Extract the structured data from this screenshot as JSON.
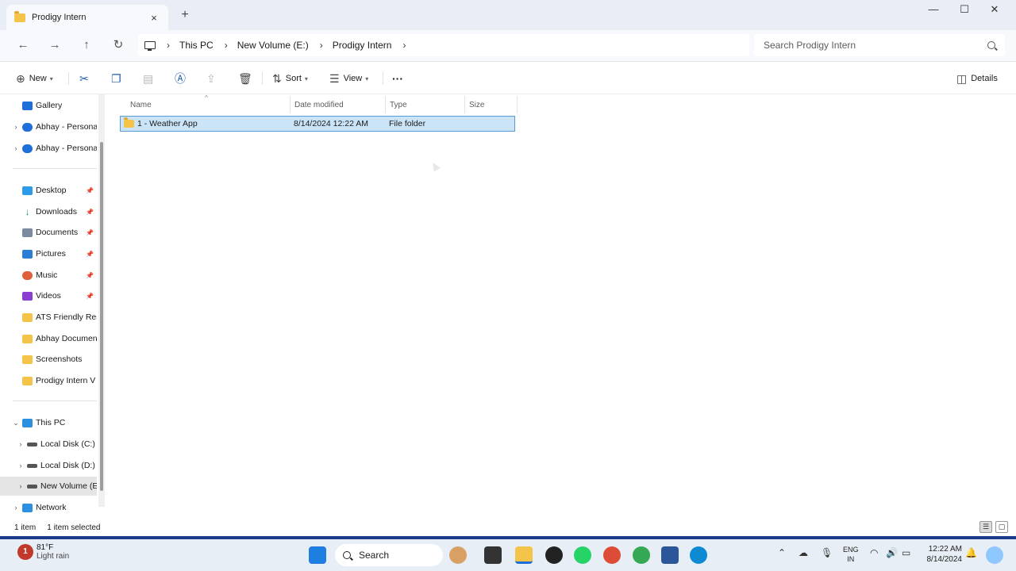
{
  "window": {
    "tab_title": "Prodigy Intern",
    "new_tab": "+",
    "tab_close": "×"
  },
  "address": {
    "breadcrumbs": [
      "This PC",
      "New Volume (E:)",
      "Prodigy Intern"
    ],
    "search_placeholder": "Search Prodigy Intern"
  },
  "toolbar": {
    "new_label": "New",
    "sort_label": "Sort",
    "view_label": "View",
    "details_label": "Details",
    "more": "···"
  },
  "nav": {
    "items": [
      {
        "label": "Gallery",
        "color": "#1e6fd9"
      },
      {
        "label": "Abhay - Persona",
        "color": "#1e6fd9"
      },
      {
        "label": "Abhay - Persona",
        "color": "#1e6fd9"
      },
      {
        "label": "Desktop",
        "color": "#2d9be8"
      },
      {
        "label": "Downloads",
        "color": "#1a9a6a"
      },
      {
        "label": "Documents",
        "color": "#7a8aa0"
      },
      {
        "label": "Pictures",
        "color": "#2a7fd4"
      },
      {
        "label": "Music",
        "color": "#e0603a"
      },
      {
        "label": "Videos",
        "color": "#8a3fd1"
      },
      {
        "label": "ATS Friendly Res",
        "color": "#f3c34a"
      },
      {
        "label": "Abhay Documen",
        "color": "#f3c34a"
      },
      {
        "label": "Screenshots",
        "color": "#f3c34a"
      },
      {
        "label": "Prodigy Intern V",
        "color": "#f3c34a"
      },
      {
        "label": "This PC",
        "color": "#2d8fe0"
      },
      {
        "label": "Local Disk (C:)",
        "color": "#555555"
      },
      {
        "label": "Local Disk (D:)",
        "color": "#555555"
      },
      {
        "label": "New Volume (E",
        "color": "#555555"
      },
      {
        "label": "Network",
        "color": "#2d8fe0"
      }
    ]
  },
  "columns": {
    "name": "Name",
    "date": "Date modified",
    "type": "Type",
    "size": "Size"
  },
  "files": [
    {
      "name": "1 - Weather App",
      "date": "8/14/2024 12:22 AM",
      "type": "File folder",
      "size": ""
    }
  ],
  "status": {
    "count": "1 item",
    "selected": "1 item selected"
  },
  "taskbar": {
    "weather_badge": "1",
    "temp": "81°F",
    "condition": "Light rain",
    "search": "Search",
    "lang1": "ENG",
    "lang2": "IN",
    "time": "12:22 AM",
    "date": "8/14/2024"
  }
}
